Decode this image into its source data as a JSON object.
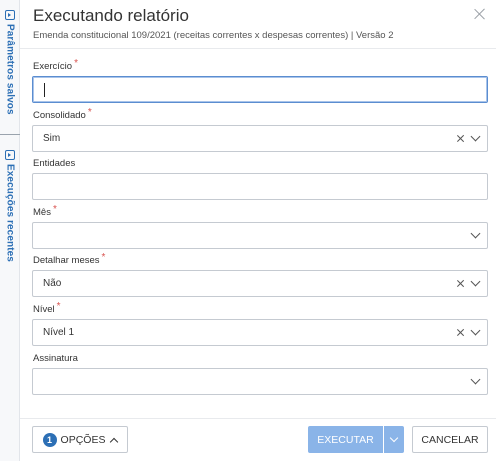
{
  "sidebar": {
    "tabs": [
      {
        "label": "Parâmetros salvos"
      },
      {
        "label": "Execuções recentes"
      }
    ]
  },
  "dialog": {
    "title": "Executando relatório",
    "subtitle": "Emenda constitucional 109/2021 (receitas correntes x despesas correntes) | Versão 2"
  },
  "fields": {
    "exercicio": {
      "label": "Exercício",
      "required": "*",
      "value": ""
    },
    "consolidado": {
      "label": "Consolidado",
      "required": "*",
      "value": "Sim"
    },
    "entidades": {
      "label": "Entidades",
      "value": ""
    },
    "mes": {
      "label": "Mês",
      "required": "*",
      "value": ""
    },
    "detalhar_meses": {
      "label": "Detalhar meses",
      "required": "*",
      "value": "Não"
    },
    "nivel": {
      "label": "Nível",
      "required": "*",
      "value": "Nível 1"
    },
    "assinatura": {
      "label": "Assinatura",
      "value": ""
    }
  },
  "footer": {
    "options_count": "1",
    "options_label": "OPÇÕES",
    "execute_label": "EXECUTAR",
    "cancel_label": "CANCELAR"
  },
  "colors": {
    "accent": "#2c6fb5",
    "execute_bg": "#8ab4e8",
    "required": "#d9534f"
  }
}
